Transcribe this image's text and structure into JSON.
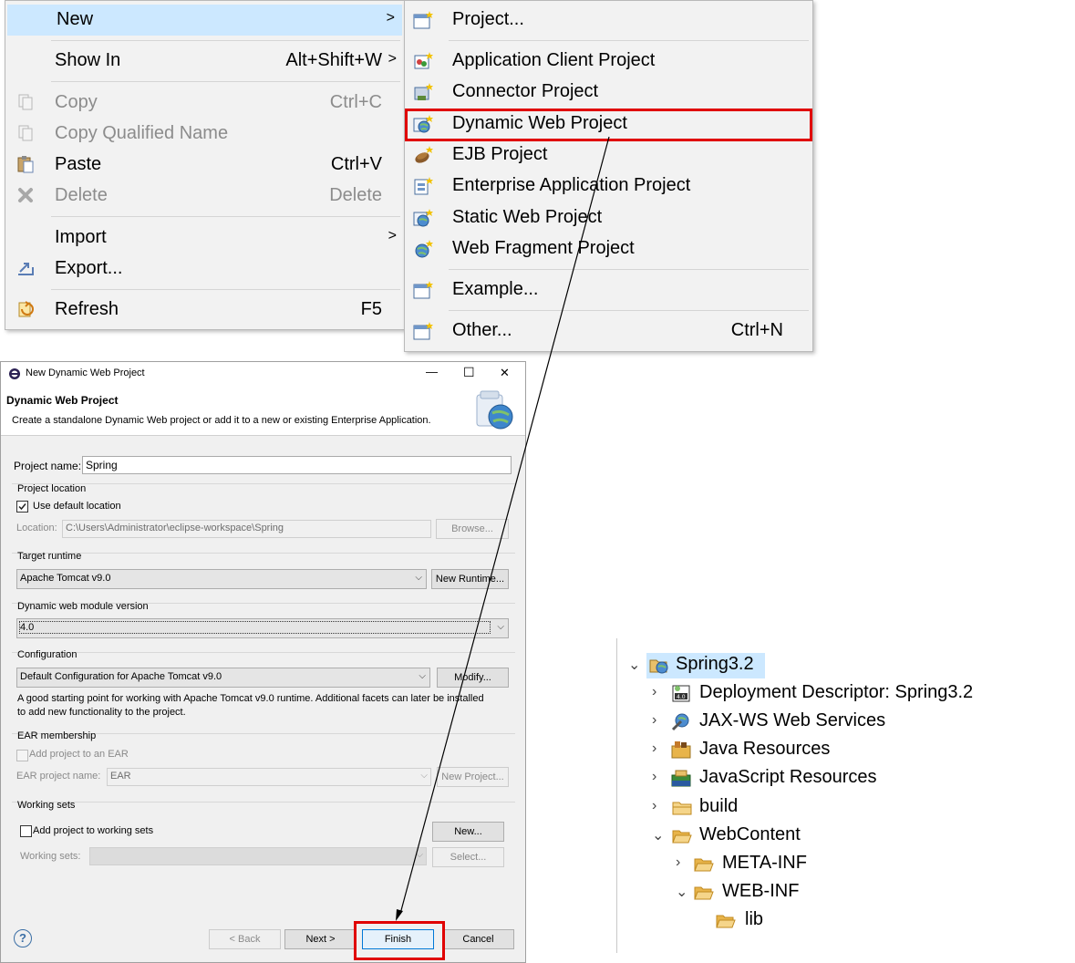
{
  "context_menu": {
    "items": [
      {
        "label": "New",
        "shortcut": "",
        "submenu": true,
        "enabled": true,
        "highlighted": true
      },
      {
        "label": "Show In",
        "shortcut": "Alt+Shift+W",
        "submenu": true,
        "enabled": true
      },
      {
        "label": "Copy",
        "shortcut": "Ctrl+C",
        "enabled": false
      },
      {
        "label": "Copy Qualified Name",
        "shortcut": "",
        "enabled": false
      },
      {
        "label": "Paste",
        "shortcut": "Ctrl+V",
        "enabled": true
      },
      {
        "label": "Delete",
        "shortcut": "Delete",
        "enabled": false
      },
      {
        "label": "Import",
        "shortcut": "",
        "submenu": true,
        "enabled": true
      },
      {
        "label": "Export...",
        "shortcut": "",
        "enabled": true
      },
      {
        "label": "Refresh",
        "shortcut": "F5",
        "enabled": true
      }
    ],
    "submenu_arrow": ">"
  },
  "new_submenu": {
    "items": [
      {
        "label": "Project...",
        "shortcut": ""
      },
      {
        "label": "Application Client Project",
        "shortcut": ""
      },
      {
        "label": "Connector Project",
        "shortcut": ""
      },
      {
        "label": "Dynamic Web Project",
        "shortcut": "",
        "highlighted": true
      },
      {
        "label": "EJB Project",
        "shortcut": ""
      },
      {
        "label": "Enterprise Application Project",
        "shortcut": ""
      },
      {
        "label": "Static Web Project",
        "shortcut": ""
      },
      {
        "label": "Web Fragment Project",
        "shortcut": ""
      },
      {
        "label": "Example...",
        "shortcut": ""
      },
      {
        "label": "Other...",
        "shortcut": "Ctrl+N"
      }
    ]
  },
  "dialog": {
    "window_title": "New Dynamic Web Project",
    "page_title": "Dynamic Web Project",
    "page_description": "Create a standalone Dynamic Web project or add it to a new or existing Enterprise Application.",
    "project_name_label": "Project name:",
    "project_name_value": "Spring",
    "project_location": {
      "group_label": "Project location",
      "use_default_label": "Use default location",
      "use_default_checked": true,
      "location_label": "Location:",
      "location_value": "C:\\Users\\Administrator\\eclipse-workspace\\Spring",
      "browse_label": "Browse..."
    },
    "target_runtime": {
      "group_label": "Target runtime",
      "value": "Apache Tomcat v9.0",
      "new_runtime_label": "New Runtime..."
    },
    "module_version": {
      "group_label": "Dynamic web module version",
      "value": "4.0"
    },
    "configuration": {
      "group_label": "Configuration",
      "value": "Default Configuration for Apache Tomcat v9.0",
      "modify_label": "Modify...",
      "description": "A good starting point for working with Apache Tomcat v9.0 runtime. Additional facets can later be installed to add new functionality to the project."
    },
    "ear_membership": {
      "group_label": "EAR membership",
      "add_label": "Add project to an EAR",
      "add_checked": false,
      "ear_name_label": "EAR project name:",
      "ear_name_value": "EAR",
      "new_project_label": "New Project..."
    },
    "working_sets": {
      "group_label": "Working sets",
      "add_label": "Add project to working sets",
      "add_checked": false,
      "new_label": "New...",
      "working_sets_label": "Working sets:",
      "select_label": "Select..."
    },
    "buttons": {
      "help": "?",
      "back": "< Back",
      "next": "Next >",
      "finish": "Finish",
      "cancel": "Cancel"
    },
    "controls": {
      "minimize": "—",
      "maximize": "☐",
      "close": "✕"
    }
  },
  "project_tree": {
    "root": "Spring3.2",
    "items": [
      {
        "label": "Deployment Descriptor: Spring3.2",
        "icon": "deployment-descriptor-icon",
        "expanded": false
      },
      {
        "label": "JAX-WS Web Services",
        "icon": "web-services-icon",
        "expanded": false
      },
      {
        "label": "Java Resources",
        "icon": "java-resources-icon",
        "expanded": false
      },
      {
        "label": "JavaScript Resources",
        "icon": "javascript-resources-icon",
        "expanded": false
      },
      {
        "label": "build",
        "icon": "folder-icon",
        "expanded": false
      },
      {
        "label": "WebContent",
        "icon": "folder-icon",
        "expanded": true
      },
      {
        "label": "META-INF",
        "icon": "folder-icon",
        "expanded": false
      },
      {
        "label": "WEB-INF",
        "icon": "folder-icon",
        "expanded": true
      },
      {
        "label": "lib",
        "icon": "folder-icon",
        "expanded": false
      }
    ]
  },
  "colors": {
    "highlight_box": "#e00000",
    "menu_hover": "#cce8ff",
    "menu_bg": "#f2f2f2",
    "dialog_bg": "#f0f0f0",
    "folder": "#e8b44a",
    "tree_selected": "#cce8ff"
  }
}
